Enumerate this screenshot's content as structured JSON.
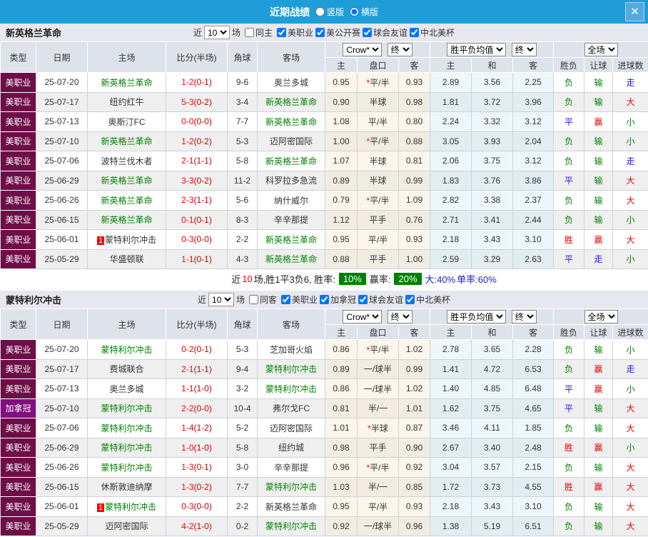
{
  "colors": {
    "accent_blue": "#1F9DD9",
    "league_mls_bg": "#6E0E48",
    "league_canada_bg": "#80107E",
    "team_highlight_green": "#008000",
    "win_red": "#E60000",
    "draw_blue": "#1A1AE6",
    "lose_green": "#008000",
    "score_red": "#FF0000",
    "badge_green": "#008000"
  },
  "titlebar": {
    "title": "近期战绩",
    "vertical_label": "竖版",
    "horizontal_label": "横版",
    "layout_selected": "横版",
    "close_icon": "✕"
  },
  "controls": {
    "odds_source": "Crow*",
    "final_label": "终",
    "avg_label": "胜平负均值",
    "scope_label": "全场"
  },
  "table_columns": {
    "type": "类型",
    "date": "日期",
    "home": "主场",
    "score": "比分(半场)",
    "corners": "角球",
    "away": "客场",
    "odds_home": "主",
    "handicap": "盘口",
    "odds_away": "客",
    "avg_home": "主",
    "avg_draw": "和",
    "avg_away": "客",
    "result": "胜负",
    "handicap_result": "让球",
    "goals": "进球数"
  },
  "sections": [
    {
      "team": "新英格兰革命",
      "filter": {
        "near_label": "近",
        "count": "10",
        "matches_label": "场",
        "same_label": "同主",
        "same_checked": false,
        "leagues": [
          {
            "label": "美职业",
            "checked": true
          },
          {
            "label": "美公开赛",
            "checked": true
          },
          {
            "label": "球会友谊",
            "checked": true
          },
          {
            "label": "中北美杯",
            "checked": true
          }
        ]
      },
      "rows": [
        {
          "type": "美职业",
          "date": "25-07-20",
          "home": "新英格兰革命",
          "home_card": "",
          "home_hl": true,
          "score": "1-2",
          "half": "(0-1)",
          "corners": "9-6",
          "away": "奥兰多城",
          "away_card": "",
          "away_hl": false,
          "odds_home": "0.95",
          "handicap_star": "*",
          "handicap": "平/半",
          "odds_away": "0.93",
          "avg_home": "2.89",
          "avg_draw": "3.56",
          "avg_away": "2.25",
          "result": "负",
          "handicap_result": "输",
          "goals_result": "走"
        },
        {
          "type": "美职业",
          "date": "25-07-17",
          "home": "纽约红牛",
          "home_card": "",
          "home_hl": false,
          "score": "5-3",
          "half": "(0-2)",
          "corners": "3-4",
          "away": "新英格兰革命",
          "away_card": "",
          "away_hl": true,
          "odds_home": "0.90",
          "handicap_star": "",
          "handicap": "半球",
          "odds_away": "0.98",
          "avg_home": "1.81",
          "avg_draw": "3.72",
          "avg_away": "3.96",
          "result": "负",
          "handicap_result": "输",
          "goals_result": "大"
        },
        {
          "type": "美职业",
          "date": "25-07-13",
          "home": "奥斯汀FC",
          "home_card": "",
          "home_hl": false,
          "score": "0-0",
          "half": "(0-0)",
          "corners": "7-7",
          "away": "新英格兰革命",
          "away_card": "",
          "away_hl": true,
          "odds_home": "1.08",
          "handicap_star": "",
          "handicap": "平/半",
          "odds_away": "0.80",
          "avg_home": "2.24",
          "avg_draw": "3.32",
          "avg_away": "3.12",
          "result": "平",
          "handicap_result": "赢",
          "goals_result": "小"
        },
        {
          "type": "美职业",
          "date": "25-07-10",
          "home": "新英格兰革命",
          "home_card": "",
          "home_hl": true,
          "score": "1-2",
          "half": "(0-2)",
          "corners": "5-3",
          "away": "迈阿密国际",
          "away_card": "",
          "away_hl": false,
          "odds_home": "1.00",
          "handicap_star": "*",
          "handicap": "平/半",
          "odds_away": "0.88",
          "avg_home": "3.05",
          "avg_draw": "3.93",
          "avg_away": "2.04",
          "result": "负",
          "handicap_result": "输",
          "goals_result": "小"
        },
        {
          "type": "美职业",
          "date": "25-07-06",
          "home": "波特兰伐木者",
          "home_card": "",
          "home_hl": false,
          "score": "2-1",
          "half": "(1-1)",
          "corners": "5-8",
          "away": "新英格兰革命",
          "away_card": "",
          "away_hl": true,
          "odds_home": "1.07",
          "handicap_star": "",
          "handicap": "半球",
          "odds_away": "0.81",
          "avg_home": "2.06",
          "avg_draw": "3.75",
          "avg_away": "3.12",
          "result": "负",
          "handicap_result": "输",
          "goals_result": "走"
        },
        {
          "type": "美职业",
          "date": "25-06-29",
          "home": "新英格兰革命",
          "home_card": "",
          "home_hl": true,
          "score": "3-3",
          "half": "(0-2)",
          "corners": "11-2",
          "away": "科罗拉多急流",
          "away_card": "",
          "away_hl": false,
          "odds_home": "0.89",
          "handicap_star": "",
          "handicap": "半球",
          "odds_away": "0.99",
          "avg_home": "1.83",
          "avg_draw": "3.76",
          "avg_away": "3.86",
          "result": "平",
          "handicap_result": "输",
          "goals_result": "大"
        },
        {
          "type": "美职业",
          "date": "25-06-26",
          "home": "新英格兰革命",
          "home_card": "",
          "home_hl": true,
          "score": "2-3",
          "half": "(1-1)",
          "corners": "5-6",
          "away": "纳什威尔",
          "away_card": "",
          "away_hl": false,
          "odds_home": "0.79",
          "handicap_star": "*",
          "handicap": "平/半",
          "odds_away": "1.09",
          "avg_home": "2.82",
          "avg_draw": "3.38",
          "avg_away": "2.37",
          "result": "负",
          "handicap_result": "输",
          "goals_result": "大"
        },
        {
          "type": "美职业",
          "date": "25-06-15",
          "home": "新英格兰革命",
          "home_card": "",
          "home_hl": true,
          "score": "0-1",
          "half": "(0-1)",
          "corners": "8-3",
          "away": "辛辛那提",
          "away_card": "",
          "away_hl": false,
          "odds_home": "1.12",
          "handicap_star": "",
          "handicap": "平手",
          "odds_away": "0.76",
          "avg_home": "2.71",
          "avg_draw": "3.41",
          "avg_away": "2.44",
          "result": "负",
          "handicap_result": "输",
          "goals_result": "小"
        },
        {
          "type": "美职业",
          "date": "25-06-01",
          "home": "蒙特利尔冲击",
          "home_card": "1",
          "home_hl": false,
          "score": "0-3",
          "half": "(0-0)",
          "corners": "2-2",
          "away": "新英格兰革命",
          "away_card": "",
          "away_hl": true,
          "odds_home": "0.95",
          "handicap_star": "",
          "handicap": "平/半",
          "odds_away": "0.93",
          "avg_home": "2.18",
          "avg_draw": "3.43",
          "avg_away": "3.10",
          "result": "胜",
          "handicap_result": "赢",
          "goals_result": "大"
        },
        {
          "type": "美职业",
          "date": "25-05-29",
          "home": "华盛顿联",
          "home_card": "",
          "home_hl": false,
          "score": "1-1",
          "half": "(0-1)",
          "corners": "4-3",
          "away": "新英格兰革命",
          "away_card": "",
          "away_hl": true,
          "odds_home": "0.88",
          "handicap_star": "",
          "handicap": "平手",
          "odds_away": "1.00",
          "avg_home": "2.59",
          "avg_draw": "3.29",
          "avg_away": "2.63",
          "result": "平",
          "handicap_result": "走",
          "goals_result": "小"
        }
      ],
      "summary": {
        "near_label": "近",
        "near_count": "10",
        "record": "场,胜1平3负6, 胜率:",
        "win_rate": "10%",
        "handicap_label": "赢率:",
        "handicap_rate": "20%",
        "big_text": "大:40%",
        "single_text": "单率:60%"
      }
    },
    {
      "team": "蒙特利尔冲击",
      "filter": {
        "near_label": "近",
        "count": "10",
        "matches_label": "场",
        "same_label": "同客",
        "same_checked": false,
        "leagues": [
          {
            "label": "美职业",
            "checked": true
          },
          {
            "label": "加拿冠",
            "checked": true
          },
          {
            "label": "球会友谊",
            "checked": true
          },
          {
            "label": "中北美杯",
            "checked": true
          }
        ]
      },
      "rows": [
        {
          "type": "美职业",
          "date": "25-07-20",
          "home": "蒙特利尔冲击",
          "home_card": "",
          "home_hl": true,
          "score": "0-2",
          "half": "(0-1)",
          "corners": "5-3",
          "away": "芝加哥火焰",
          "away_card": "",
          "away_hl": false,
          "odds_home": "0.86",
          "handicap_star": "*",
          "handicap": "平/半",
          "odds_away": "1.02",
          "avg_home": "2.78",
          "avg_draw": "3.65",
          "avg_away": "2.28",
          "result": "负",
          "handicap_result": "输",
          "goals_result": "小"
        },
        {
          "type": "美职业",
          "date": "25-07-17",
          "home": "费城联合",
          "home_card": "",
          "home_hl": false,
          "score": "2-1",
          "half": "(1-1)",
          "corners": "9-4",
          "away": "蒙特利尔冲击",
          "away_card": "",
          "away_hl": true,
          "odds_home": "0.89",
          "handicap_star": "",
          "handicap": "一/球半",
          "odds_away": "0.99",
          "avg_home": "1.41",
          "avg_draw": "4.72",
          "avg_away": "6.53",
          "result": "负",
          "handicap_result": "赢",
          "goals_result": "走"
        },
        {
          "type": "美职业",
          "date": "25-07-13",
          "home": "奥兰多城",
          "home_card": "",
          "home_hl": false,
          "score": "1-1",
          "half": "(1-0)",
          "corners": "3-2",
          "away": "蒙特利尔冲击",
          "away_card": "",
          "away_hl": true,
          "odds_home": "0.86",
          "handicap_star": "",
          "handicap": "一/球半",
          "odds_away": "1.02",
          "avg_home": "1.40",
          "avg_draw": "4.85",
          "avg_away": "6.48",
          "result": "平",
          "handicap_result": "赢",
          "goals_result": "小"
        },
        {
          "type": "加拿冠",
          "date": "25-07-10",
          "home": "蒙特利尔冲击",
          "home_card": "",
          "home_hl": true,
          "score": "2-2",
          "half": "(0-0)",
          "corners": "10-4",
          "away": "弗尔戈FC",
          "away_card": "",
          "away_hl": false,
          "odds_home": "0.81",
          "handicap_star": "",
          "handicap": "半/一",
          "odds_away": "1.01",
          "avg_home": "1.62",
          "avg_draw": "3.75",
          "avg_away": "4.65",
          "result": "平",
          "handicap_result": "输",
          "goals_result": "大"
        },
        {
          "type": "美职业",
          "date": "25-07-06",
          "home": "蒙特利尔冲击",
          "home_card": "",
          "home_hl": true,
          "score": "1-4",
          "half": "(1-2)",
          "corners": "5-2",
          "away": "迈阿密国际",
          "away_card": "",
          "away_hl": false,
          "odds_home": "1.01",
          "handicap_star": "*",
          "handicap": "半球",
          "odds_away": "0.87",
          "avg_home": "3.46",
          "avg_draw": "4.11",
          "avg_away": "1.85",
          "result": "负",
          "handicap_result": "输",
          "goals_result": "大"
        },
        {
          "type": "美职业",
          "date": "25-06-29",
          "home": "蒙特利尔冲击",
          "home_card": "",
          "home_hl": true,
          "score": "1-0",
          "half": "(1-0)",
          "corners": "5-8",
          "away": "纽约城",
          "away_card": "",
          "away_hl": false,
          "odds_home": "0.98",
          "handicap_star": "",
          "handicap": "平手",
          "odds_away": "0.90",
          "avg_home": "2.67",
          "avg_draw": "3.40",
          "avg_away": "2.48",
          "result": "胜",
          "handicap_result": "赢",
          "goals_result": "小"
        },
        {
          "type": "美职业",
          "date": "25-06-26",
          "home": "蒙特利尔冲击",
          "home_card": "",
          "home_hl": true,
          "score": "1-3",
          "half": "(0-1)",
          "corners": "3-0",
          "away": "辛辛那提",
          "away_card": "",
          "away_hl": false,
          "odds_home": "0.96",
          "handicap_star": "*",
          "handicap": "平/半",
          "odds_away": "0.92",
          "avg_home": "3.04",
          "avg_draw": "3.57",
          "avg_away": "2.15",
          "result": "负",
          "handicap_result": "输",
          "goals_result": "大"
        },
        {
          "type": "美职业",
          "date": "25-06-15",
          "home": "休斯敦迪纳摩",
          "home_card": "",
          "home_hl": false,
          "score": "1-3",
          "half": "(0-2)",
          "corners": "7-7",
          "away": "蒙特利尔冲击",
          "away_card": "",
          "away_hl": true,
          "odds_home": "1.03",
          "handicap_star": "",
          "handicap": "半/一",
          "odds_away": "0.85",
          "avg_home": "1.72",
          "avg_draw": "3.73",
          "avg_away": "4.55",
          "result": "胜",
          "handicap_result": "赢",
          "goals_result": "大"
        },
        {
          "type": "美职业",
          "date": "25-06-01",
          "home": "蒙特利尔冲击",
          "home_card": "1",
          "home_hl": true,
          "score": "0-3",
          "half": "(0-0)",
          "corners": "2-2",
          "away": "新英格兰革命",
          "away_card": "",
          "away_hl": false,
          "odds_home": "0.95",
          "handicap_star": "",
          "handicap": "平/半",
          "odds_away": "0.93",
          "avg_home": "2.18",
          "avg_draw": "3.43",
          "avg_away": "3.10",
          "result": "负",
          "handicap_result": "输",
          "goals_result": "大"
        },
        {
          "type": "美职业",
          "date": "25-05-29",
          "home": "迈阿密国际",
          "home_card": "",
          "home_hl": false,
          "score": "4-2",
          "half": "(1-0)",
          "corners": "0-2",
          "away": "蒙特利尔冲击",
          "away_card": "",
          "away_hl": true,
          "odds_home": "0.92",
          "handicap_star": "",
          "handicap": "一/球半",
          "odds_away": "0.96",
          "avg_home": "1.38",
          "avg_draw": "5.19",
          "avg_away": "6.51",
          "result": "负",
          "handicap_result": "输",
          "goals_result": "大"
        }
      ]
    }
  ]
}
